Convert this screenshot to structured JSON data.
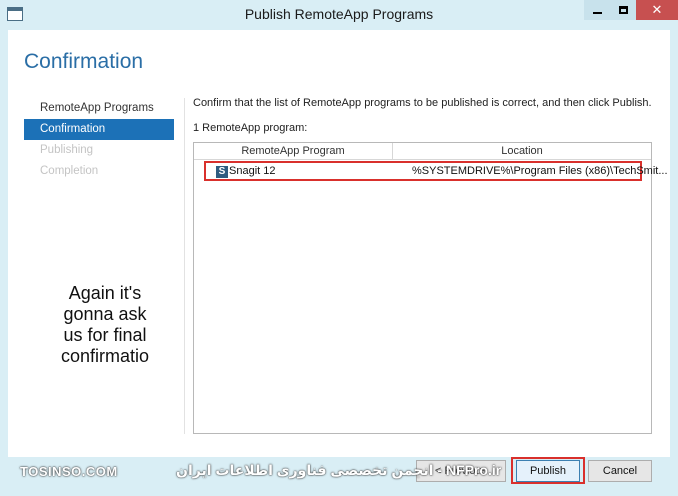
{
  "window": {
    "title": "Publish RemoteApp Programs",
    "close_glyph": "✕"
  },
  "page": {
    "title": "Confirmation"
  },
  "nav": {
    "items": [
      {
        "label": "RemoteApp Programs",
        "state": "normal"
      },
      {
        "label": "Confirmation",
        "state": "active"
      },
      {
        "label": "Publishing",
        "state": "disabled"
      },
      {
        "label": "Completion",
        "state": "disabled"
      }
    ]
  },
  "annotation": {
    "lines": [
      "Again it's",
      "gonna ask",
      "us for final",
      "confirmatio"
    ]
  },
  "main": {
    "instruction": "Confirm that the list of RemoteApp programs to be published is correct, and then click Publish.",
    "count": "1 RemoteApp program:",
    "columns": [
      "RemoteApp Program",
      "Location"
    ],
    "rows": [
      {
        "icon_letter": "S",
        "name": "Snagit 12",
        "location": "%SYSTEMDRIVE%\\Program Files (x86)\\TechSmit..."
      }
    ]
  },
  "footer": {
    "watermark_left": "TOSINSO.COM",
    "watermark_mid": "انجمن تخصصی فناوری اطلاعات ایران - NFPro.ir",
    "previous_label": "< Previous",
    "publish_label": "Publish",
    "cancel_label": "Cancel"
  },
  "colors": {
    "accent": "#1c71b7",
    "title": "#2a6ea6",
    "highlight_box": "#d9302c",
    "frame": "#d9eef5"
  }
}
